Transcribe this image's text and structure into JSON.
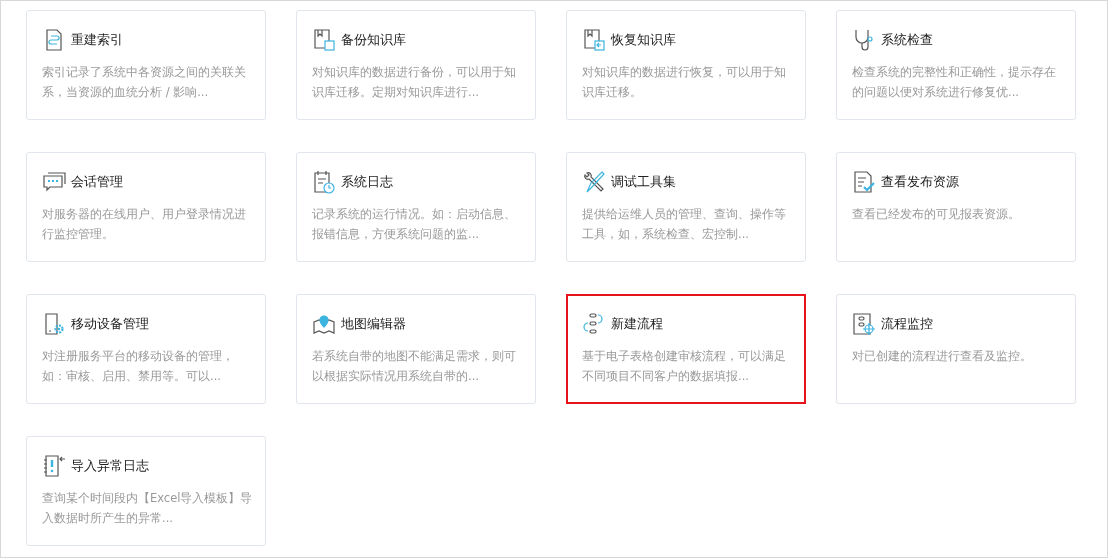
{
  "cards": [
    {
      "kind": "index",
      "title": "重建索引",
      "description": [
        "索引记录了系统中各资源之间的关联关",
        "系，当资源的血统分析 / 影响..."
      ],
      "selected": false
    },
    {
      "kind": "backup",
      "title": "备份知识库",
      "description": [
        "对知识库的数据进行备份，可以用于知",
        "识库迁移。定期对知识库进行..."
      ],
      "selected": false
    },
    {
      "kind": "restore",
      "title": "恢复知识库",
      "description": [
        "对知识库的数据进行恢复，可以用于知",
        "识库迁移。"
      ],
      "selected": false
    },
    {
      "kind": "stethoscope",
      "title": "系统检查",
      "description": [
        "检查系统的完整性和正确性，提示存在",
        "的问题以便对系统进行修复优..."
      ],
      "selected": false
    },
    {
      "kind": "chat",
      "title": "会话管理",
      "description": [
        "对服务器的在线用户、用户登录情况进",
        "行监控管理。"
      ],
      "selected": false
    },
    {
      "kind": "log",
      "title": "系统日志",
      "description": [
        "记录系统的运行情况。如：启动信息、",
        "报错信息，方便系统问题的监..."
      ],
      "selected": false
    },
    {
      "kind": "tools",
      "title": "调试工具集",
      "description": [
        "提供给运维人员的管理、查询、操作等",
        "工具，如，系统检查、宏控制..."
      ],
      "selected": false
    },
    {
      "kind": "check",
      "title": "查看发布资源",
      "description": [
        "查看已经发布的可见报表资源。"
      ],
      "selected": false
    },
    {
      "kind": "mobile",
      "title": "移动设备管理",
      "description": [
        "对注册服务平台的移动设备的管理，",
        "如：审核、启用、禁用等。可以..."
      ],
      "selected": false
    },
    {
      "kind": "map",
      "title": "地图编辑器",
      "description": [
        "若系统自带的地图不能满足需求，则可",
        "以根据实际情况用系统自带的..."
      ],
      "selected": false
    },
    {
      "kind": "flow",
      "title": "新建流程",
      "description": [
        "基于电子表格创建审核流程，可以满足",
        "不同项目不同客户的数据填报..."
      ],
      "selected": true
    },
    {
      "kind": "monitor",
      "title": "流程监控",
      "description": [
        "对已创建的流程进行查看及监控。"
      ],
      "selected": false
    },
    {
      "kind": "import",
      "title": "导入异常日志",
      "description": [
        "查询某个时间段内【Excel导入模板】导",
        "入数据时所产生的异常..."
      ],
      "selected": false
    }
  ]
}
